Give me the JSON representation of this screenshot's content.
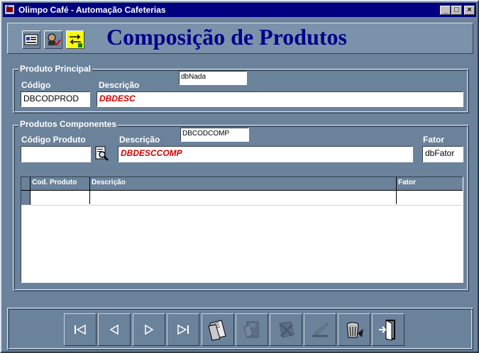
{
  "window": {
    "title": "Olimpo Café - Automação Cafeterias",
    "minimize_glyph": "_",
    "maximize_glyph": "□",
    "close_glyph": "×"
  },
  "toolbar": {
    "icons": [
      "id-card-icon",
      "user-check-icon",
      "exchange-icon"
    ]
  },
  "page": {
    "title": "Composição de Produtos"
  },
  "principal": {
    "legend": "Produto Principal",
    "codigo_label": "Código",
    "codigo_value": "DBCODPROD",
    "descricao_label": "Descrição",
    "descricao_value": "DBDESC",
    "hidden_field": "dbNada"
  },
  "componentes": {
    "legend": "Produtos Componentes",
    "codigo_label": "Código Produto",
    "codigo_value": "",
    "descricao_label": "Descrição",
    "descricao_value": "DBDESCCOMP",
    "hidden_field": "DBCODCOMP",
    "fator_label": "Fator",
    "fator_value": "dbFator"
  },
  "grid": {
    "columns": [
      "Cod. Produto",
      "Descrição",
      "Fator"
    ],
    "rows": [
      [
        "",
        "",
        ""
      ]
    ]
  },
  "nav": {
    "buttons": [
      "first-record",
      "previous-record",
      "next-record",
      "last-record",
      "open-folder",
      "save",
      "cancel",
      "edit",
      "delete",
      "exit"
    ]
  },
  "colors": {
    "title_blue": "#00008b",
    "field_red": "#d40000",
    "panel": "#6b829b",
    "titlebar": "#000080"
  }
}
